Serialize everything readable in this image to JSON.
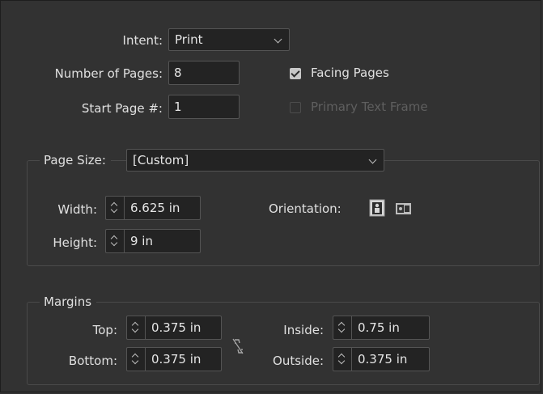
{
  "document": {
    "intent": {
      "label": "Intent:",
      "value": "Print"
    },
    "number_of_pages": {
      "label": "Number of Pages:",
      "value": "8"
    },
    "start_page": {
      "label": "Start Page #:",
      "value": "1"
    },
    "facing_pages": {
      "label": "Facing Pages",
      "checked": true
    },
    "primary_text_frame": {
      "label": "Primary Text Frame",
      "checked": false,
      "enabled": false
    }
  },
  "page_size": {
    "label": "Page Size:",
    "value": "[Custom]",
    "width": {
      "label": "Width:",
      "value": "6.625 in"
    },
    "height": {
      "label": "Height:",
      "value": "9 in"
    },
    "orientation": {
      "label": "Orientation:",
      "selected": "portrait",
      "icons": [
        "portrait-orientation-icon",
        "landscape-orientation-icon"
      ]
    }
  },
  "margins": {
    "legend": "Margins",
    "top": {
      "label": "Top:",
      "value": "0.375 in"
    },
    "bottom": {
      "label": "Bottom:",
      "value": "0.375 in"
    },
    "inside": {
      "label": "Inside:",
      "value": "0.75 in"
    },
    "outside": {
      "label": "Outside:",
      "value": "0.375 in"
    },
    "link_icon": "broken-link-icon"
  },
  "colors": {
    "background": "#323232",
    "field": "#232323",
    "border": "#545454",
    "text": "#e0e0e0",
    "disabled_text": "#5f5f5f"
  }
}
